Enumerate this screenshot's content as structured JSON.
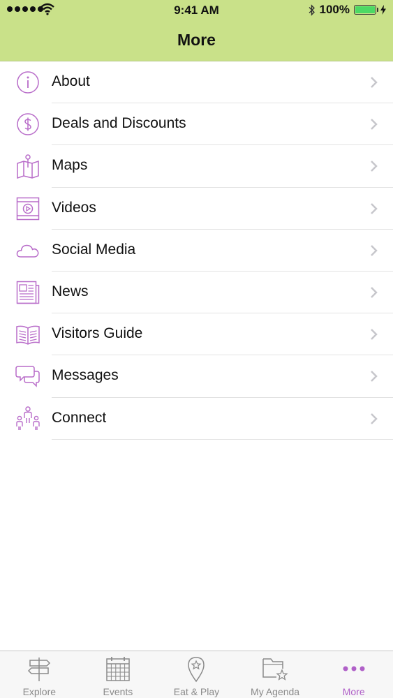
{
  "status_bar": {
    "time": "9:41 AM",
    "battery": "100%"
  },
  "header": {
    "title": "More"
  },
  "menu": [
    {
      "label": "About",
      "icon": "info-icon"
    },
    {
      "label": "Deals and Discounts",
      "icon": "dollar-icon"
    },
    {
      "label": "Maps",
      "icon": "map-icon"
    },
    {
      "label": "Videos",
      "icon": "video-icon"
    },
    {
      "label": "Social Media",
      "icon": "cloud-icon"
    },
    {
      "label": "News",
      "icon": "newspaper-icon"
    },
    {
      "label": "Visitors Guide",
      "icon": "book-icon"
    },
    {
      "label": "Messages",
      "icon": "chat-icon"
    },
    {
      "label": "Connect",
      "icon": "people-icon"
    }
  ],
  "tabs": [
    {
      "label": "Explore",
      "icon": "signpost-icon"
    },
    {
      "label": "Events",
      "icon": "calendar-icon"
    },
    {
      "label": "Eat & Play",
      "icon": "location-star-icon"
    },
    {
      "label": "My Agenda",
      "icon": "folder-star-icon"
    },
    {
      "label": "More",
      "icon": "more-dots-icon"
    }
  ],
  "colors": {
    "header_bg": "#c9e189",
    "accent": "#b060c8",
    "icon_stroke": "#b86cc9"
  }
}
